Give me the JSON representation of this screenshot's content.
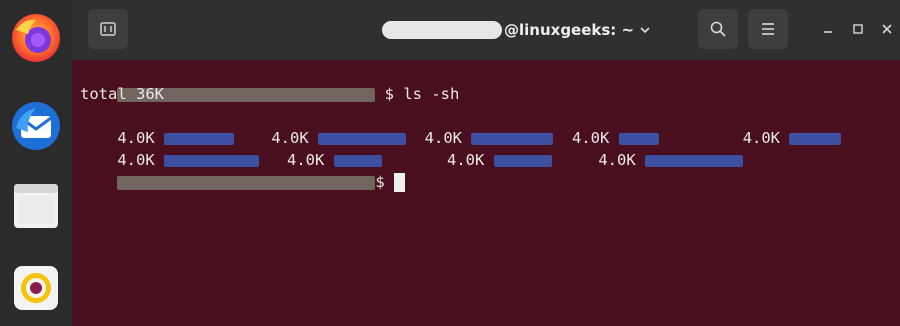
{
  "window": {
    "title_suffix": "@linuxgeeks: ~"
  },
  "dock": {
    "items": [
      {
        "name": "firefox"
      },
      {
        "name": "thunderbird"
      },
      {
        "name": "files"
      },
      {
        "name": "rhythmbox"
      }
    ]
  },
  "terminal": {
    "command": "$ ls -sh",
    "total": "total 36K",
    "size": "4.0K",
    "prompt_end": "$"
  },
  "colors": {
    "terminal_bg": "#4a0f1f",
    "headerbar_bg": "#303030",
    "dock_bg": "#2b2b2b"
  }
}
